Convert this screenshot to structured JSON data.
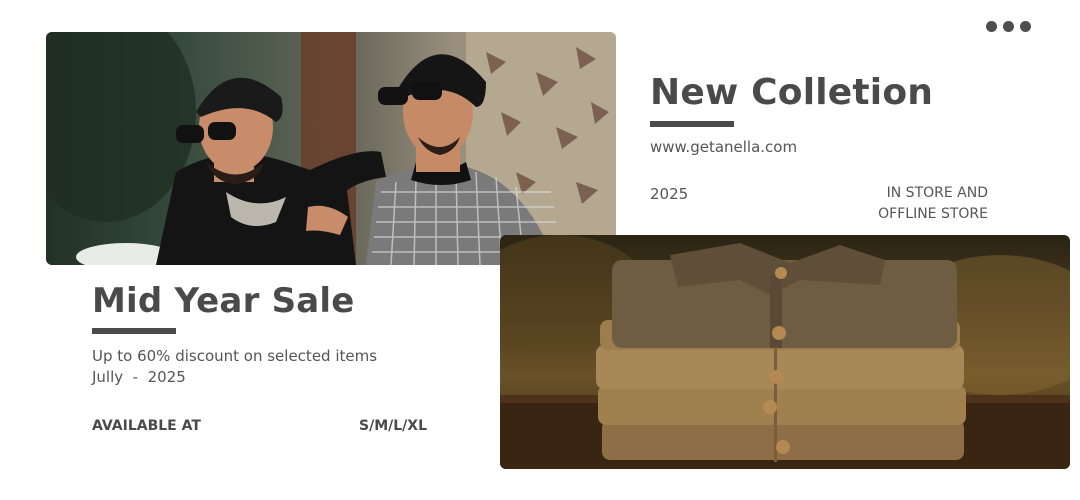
{
  "menu": {
    "icon": "more-dots-icon"
  },
  "collection": {
    "title": "New Colletion",
    "url": "www.getanella.com",
    "year": "2025",
    "store_line1": "IN STORE AND",
    "store_line2": "OFFLINE STORE"
  },
  "sale": {
    "title": "Mid Year Sale",
    "discount": "Up to 60% discount on selected items",
    "date": "Jully  -  2025",
    "available_label": "AVAILABLE AT",
    "sizes": "S/M/L/XL"
  },
  "colors": {
    "heading": "#4a4a4a",
    "background": "#ffffff"
  }
}
